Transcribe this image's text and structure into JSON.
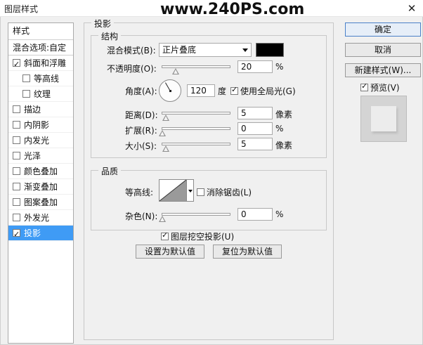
{
  "window": {
    "title": "图层样式",
    "watermark": "www.240PS.com",
    "close_glyph": "✕"
  },
  "styles_panel": {
    "header": "样式",
    "blend_options": "混合选项:自定",
    "items": [
      {
        "label": "斜面和浮雕",
        "checked": true,
        "indent": false,
        "selected": false
      },
      {
        "label": "等高线",
        "checked": false,
        "indent": true,
        "selected": false
      },
      {
        "label": "纹理",
        "checked": false,
        "indent": true,
        "selected": false
      },
      {
        "label": "描边",
        "checked": false,
        "indent": false,
        "selected": false
      },
      {
        "label": "内阴影",
        "checked": false,
        "indent": false,
        "selected": false
      },
      {
        "label": "内发光",
        "checked": false,
        "indent": false,
        "selected": false
      },
      {
        "label": "光泽",
        "checked": false,
        "indent": false,
        "selected": false
      },
      {
        "label": "颜色叠加",
        "checked": false,
        "indent": false,
        "selected": false
      },
      {
        "label": "渐变叠加",
        "checked": false,
        "indent": false,
        "selected": false
      },
      {
        "label": "图案叠加",
        "checked": false,
        "indent": false,
        "selected": false
      },
      {
        "label": "外发光",
        "checked": false,
        "indent": false,
        "selected": false
      },
      {
        "label": "投影",
        "checked": true,
        "indent": false,
        "selected": true
      }
    ]
  },
  "drop_shadow": {
    "title": "投影",
    "structure": {
      "title": "结构",
      "blend_mode_label": "混合模式(B):",
      "blend_mode_value": "正片叠底",
      "shadow_color": "#000000",
      "opacity_label": "不透明度(O):",
      "opacity_value": "20",
      "opacity_unit": "%",
      "opacity_level": 0.2,
      "angle_label": "角度(A):",
      "angle_value": "120",
      "angle_unit": "度",
      "global_light_label": "使用全局光(G)",
      "global_light_checked": true,
      "distance_label": "距离(D):",
      "distance_value": "5",
      "distance_unit": "像素",
      "spread_label": "扩展(R):",
      "spread_value": "0",
      "spread_unit": "%",
      "size_label": "大小(S):",
      "size_value": "5",
      "size_unit": "像素"
    },
    "quality": {
      "title": "品质",
      "contour_label": "等高线:",
      "anti_alias_label": "消除锯齿(L)",
      "anti_alias_checked": false,
      "noise_label": "杂色(N):",
      "noise_value": "0",
      "noise_unit": "%"
    },
    "knockout_label": "图层挖空投影(U)",
    "knockout_checked": true,
    "make_default": "设置为默认值",
    "reset_default": "复位为默认值"
  },
  "actions": {
    "ok": "确定",
    "cancel": "取消",
    "new_style": "新建样式(W)...",
    "preview_label": "预览(V)",
    "preview_checked": true
  }
}
